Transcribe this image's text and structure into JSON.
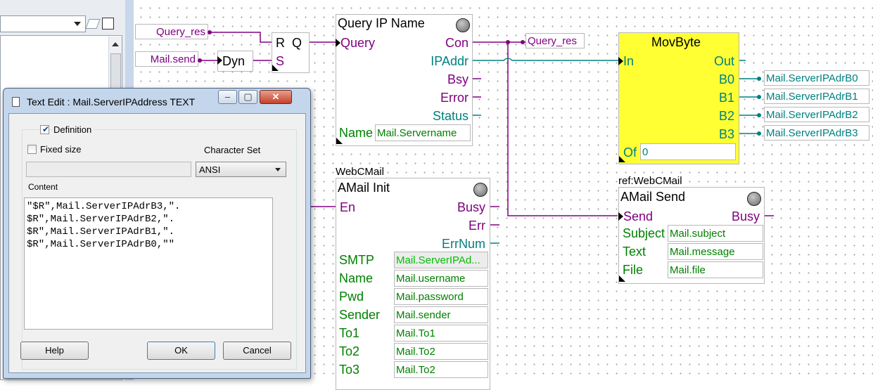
{
  "blocks": {
    "query_ip": {
      "title": "Query IP Name",
      "in_query": "Query",
      "out_con": "Con",
      "out_ipaddr": "IPAddr",
      "out_bsy": "Bsy",
      "out_error": "Error",
      "out_status": "Status",
      "name_label": "Name",
      "name_value": "Mail.Servername"
    },
    "rq": {
      "r": "R",
      "q": "Q",
      "s": "S"
    },
    "dyn": {
      "title": "Dyn"
    },
    "movbyte": {
      "title": "MovByte",
      "in": "In",
      "out": "Out",
      "b0": "B0",
      "b1": "B1",
      "b2": "B2",
      "b3": "B3",
      "of_label": "Of",
      "of_value": "0"
    },
    "amail_init": {
      "ref": "WebCMail",
      "title": "AMail Init",
      "in_en": "En",
      "out_busy": "Busy",
      "out_err": "Err",
      "out_errnum": "ErrNum",
      "params": [
        {
          "label": "SMTP",
          "value": "Mail.ServerIPAd..."
        },
        {
          "label": "Name",
          "value": "Mail.username"
        },
        {
          "label": "Pwd",
          "value": "Mail.password"
        },
        {
          "label": "Sender",
          "value": "Mail.sender"
        },
        {
          "label": "To1",
          "value": "Mail.To1"
        },
        {
          "label": "To2",
          "value": "Mail.To2"
        },
        {
          "label": "To3",
          "value": "Mail.To2"
        }
      ]
    },
    "amail_send": {
      "ref": "ref:WebCMail",
      "title": "AMail Send",
      "in_send": "Send",
      "out_busy": "Busy",
      "params": [
        {
          "label": "Subject",
          "value": "Mail.subject"
        },
        {
          "label": "Text",
          "value": "Mail.message"
        },
        {
          "label": "File",
          "value": "Mail.file"
        }
      ]
    }
  },
  "labels": {
    "query_res_in": "Query_res",
    "mail_send": "Mail.send",
    "query_res_out": "Query_res",
    "b0": "Mail.ServerIPAdrB0",
    "b1": "Mail.ServerIPAdrB1",
    "b2": "Mail.ServerIPAdrB2",
    "b3": "Mail.ServerIPAdrB3"
  },
  "dialog": {
    "title": "Text Edit : Mail.ServerIPAddress TEXT",
    "minimize": "–",
    "maximize": "▢",
    "close": "✕",
    "definition_label": "Definition",
    "definition_checked": true,
    "fixed_size_label": "Fixed size",
    "fixed_size_checked": false,
    "charset_label": "Character Set",
    "charset_value": "ANSI",
    "content_label": "Content",
    "content_text": "\"$R\",Mail.ServerIPAdrB3,\".\n$R\",Mail.ServerIPAdrB2,\".\n$R\",Mail.ServerIPAdrB1,\".\n$R\",Mail.ServerIPAdrB0,\"\"",
    "help_button": "Help",
    "ok_button": "OK",
    "cancel_button": "Cancel"
  },
  "colors": {
    "purple": "#800080",
    "teal": "#008080",
    "green": "#008000",
    "yellow": "#ffff33",
    "grid_dot": "#9a9a9a"
  },
  "icons": {
    "dropdown": "chevron-down-icon",
    "clear": "eraser-icon",
    "properties": "properties-icon",
    "scroll_up": "scroll-up-icon",
    "dialog": "document-icon"
  }
}
